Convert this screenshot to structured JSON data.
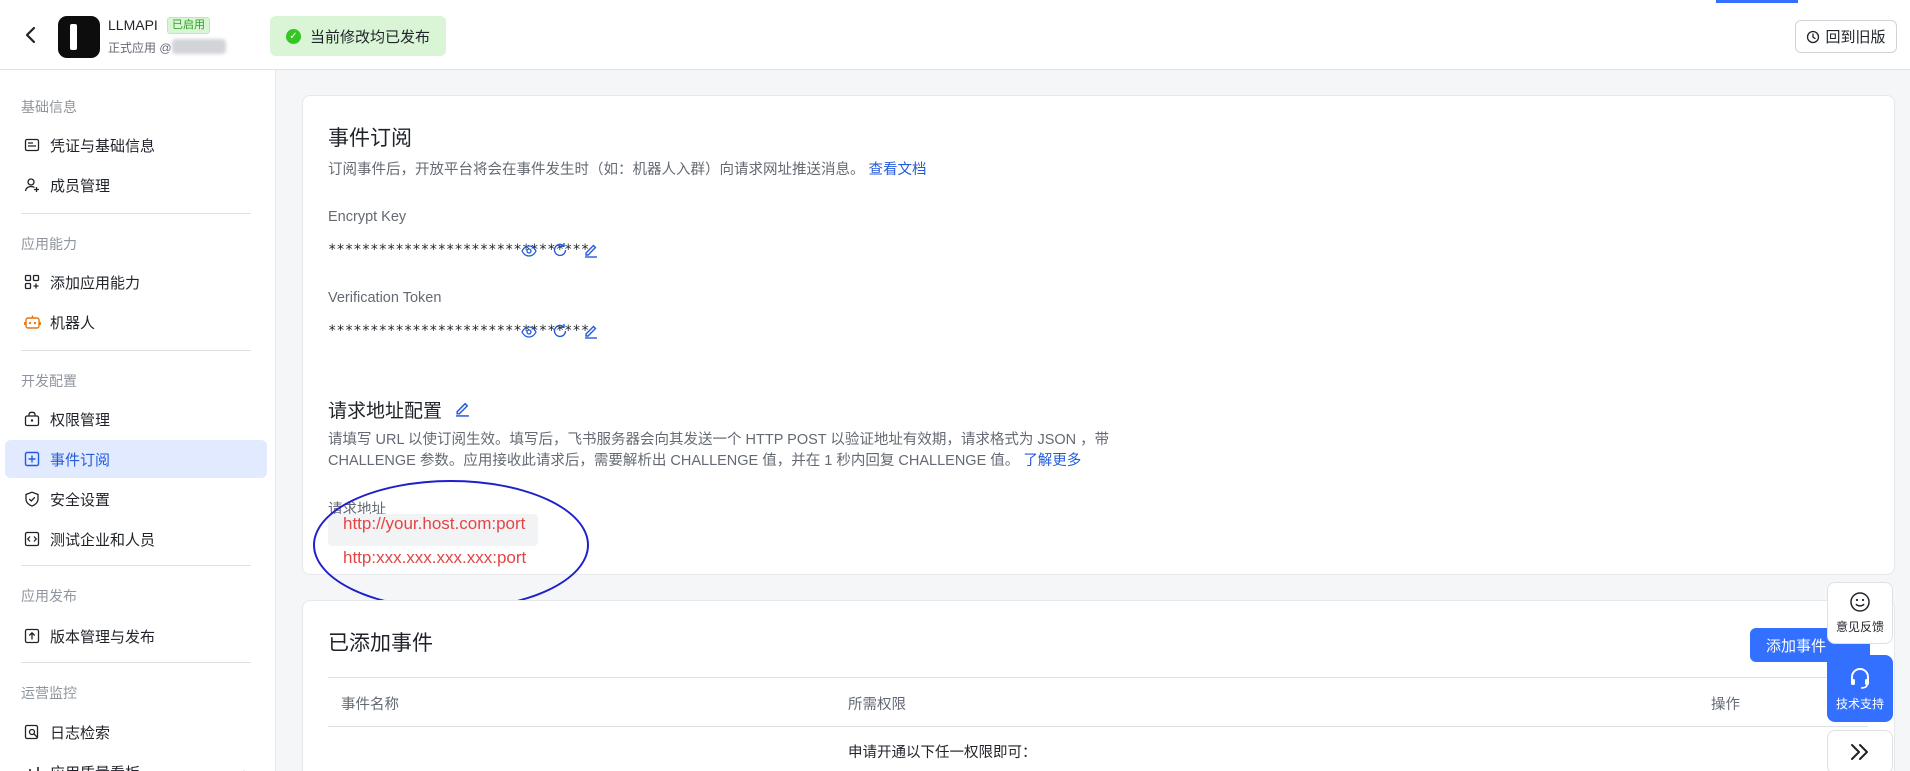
{
  "header": {
    "app_name": "LLMAPI",
    "app_status_badge": "已启用",
    "app_type": "正式应用 @",
    "publish_status": "当前修改均已发布",
    "revert_label": "回到旧版"
  },
  "sidebar": {
    "groups": [
      {
        "title": "基础信息",
        "items": [
          {
            "label": "凭证与基础信息",
            "icon": "id-card-icon"
          },
          {
            "label": "成员管理",
            "icon": "user-add-icon"
          }
        ]
      },
      {
        "title": "应用能力",
        "items": [
          {
            "label": "添加应用能力",
            "icon": "grid-add-icon"
          },
          {
            "label": "机器人",
            "icon": "robot-icon"
          }
        ]
      },
      {
        "title": "开发配置",
        "items": [
          {
            "label": "权限管理",
            "icon": "lock-box-icon"
          },
          {
            "label": "事件订阅",
            "icon": "event-subscribe-icon",
            "active": true
          },
          {
            "label": "安全设置",
            "icon": "shield-check-icon"
          },
          {
            "label": "测试企业和人员",
            "icon": "code-box-icon"
          }
        ]
      },
      {
        "title": "应用发布",
        "items": [
          {
            "label": "版本管理与发布",
            "icon": "upload-box-icon"
          }
        ]
      },
      {
        "title": "运营监控",
        "items": [
          {
            "label": "日志检索",
            "icon": "log-search-icon"
          },
          {
            "label": "应用质量看板",
            "icon": "chart-icon"
          }
        ]
      }
    ]
  },
  "event_subscription": {
    "title": "事件订阅",
    "description": "订阅事件后，开放平台将会在事件发生时（如：机器人入群）向请求网址推送消息。",
    "doc_link": "查看文档",
    "encrypt_key_label": "Encrypt Key",
    "encrypt_key_value": "*******************************",
    "verification_token_label": "Verification Token",
    "verification_token_value": "*******************************"
  },
  "request_url_config": {
    "title": "请求地址配置",
    "description_line1": "请填写 URL 以使订阅生效。填写后，飞书服务器会向其发送一个 HTTP POST 以验证地址有效期，请求格式为 JSON ，带",
    "description_line2": "CHALLENGE 参数。应用接收此请求后，需要解析出 CHALLENGE 值，并在 1 秒内回复 CHALLENGE 值。",
    "learn_more": "了解更多",
    "field_label": "请求地址",
    "url_example_1": "http://your.host.com:port",
    "url_example_2": "http:xxx.xxx.xxx.xxx:port"
  },
  "added_events": {
    "title": "已添加事件",
    "add_button": "添加事件",
    "columns": [
      "事件名称",
      "所需权限",
      "操作"
    ],
    "first_row_permission": "申请开通以下任一权限即可："
  },
  "float_widgets": {
    "feedback": "意见反馈",
    "support": "技术支持"
  },
  "colors": {
    "accent": "#3370ff",
    "active_bg": "#e1eaff",
    "success_bg": "#d9f5d6",
    "annotation_ellipse": "#1f1fcc",
    "annotation_text": "#e54545"
  }
}
